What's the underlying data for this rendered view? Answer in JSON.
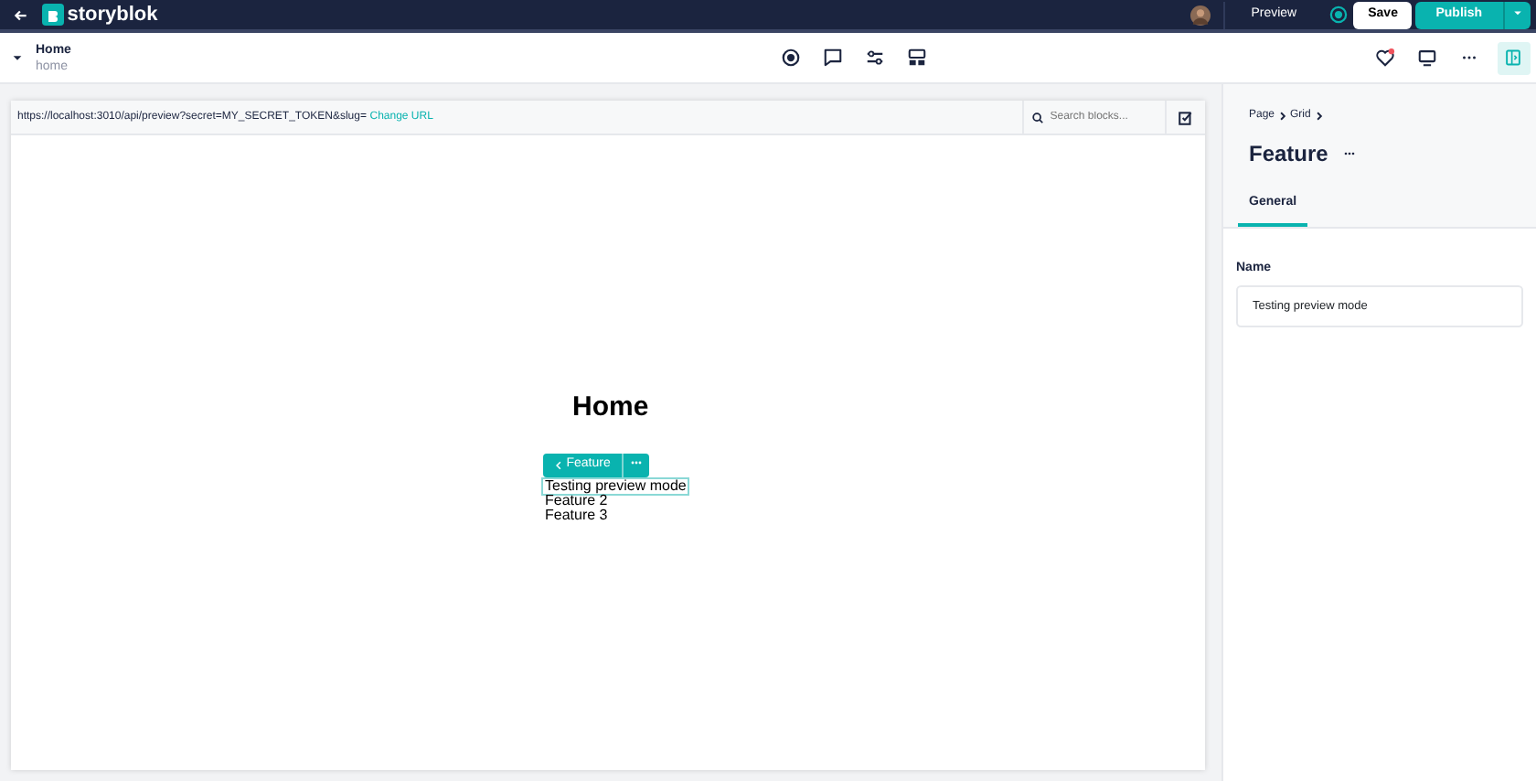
{
  "topbar": {
    "brand": "storyblok",
    "preview": "Preview",
    "save": "Save",
    "publish": "Publish"
  },
  "story": {
    "title": "Home",
    "slug": "home"
  },
  "toolbar": {
    "tools": [
      {
        "kind": "record",
        "selected": false
      },
      {
        "kind": "comment",
        "selected": false
      },
      {
        "kind": "sliders",
        "selected": false
      },
      {
        "kind": "blocks",
        "selected": false
      }
    ],
    "right": [
      {
        "kind": "heart",
        "selected": false
      },
      {
        "kind": "monitor",
        "selected": false
      },
      {
        "kind": "more",
        "selected": false
      },
      {
        "kind": "panel",
        "selected": true
      }
    ]
  },
  "preview": {
    "url": "https://localhost:3010/api/preview?secret=MY_SECRET_TOKEN&slug=",
    "change_url": "Change URL",
    "search_placeholder": "Search blocks...",
    "heading": "Home",
    "block_label": "Feature",
    "items": [
      {
        "text": "Testing preview mode",
        "selected": true
      },
      {
        "text": "Feature 2",
        "selected": false
      },
      {
        "text": "Feature 3",
        "selected": false
      }
    ]
  },
  "panel": {
    "breadcrumbs": [
      "Page",
      "Grid"
    ],
    "title": "Feature",
    "tabs": [
      {
        "label": "General",
        "selected": true
      }
    ],
    "field": {
      "label": "Name",
      "value": "Testing preview mode"
    }
  }
}
